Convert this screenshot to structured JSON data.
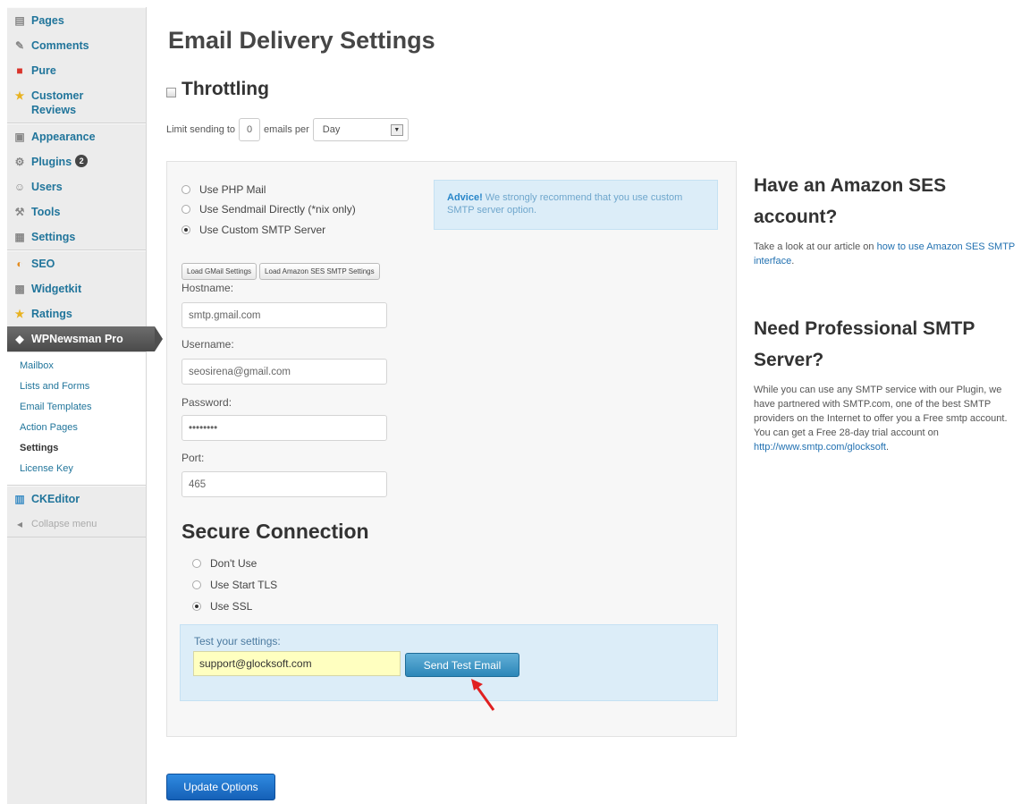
{
  "sidebar": {
    "items_top": [
      {
        "label": "Pages",
        "icon": "pages-icon",
        "glyph": "▤"
      },
      {
        "label": "Comments",
        "icon": "comments-icon",
        "glyph": "✎"
      },
      {
        "label": "Pure",
        "icon": "pure-icon",
        "glyph": "■"
      },
      {
        "label": "Customer Reviews",
        "icon": "star-icon",
        "glyph": "★"
      }
    ],
    "items_mid": [
      {
        "label": "Appearance",
        "icon": "appearance-icon",
        "glyph": "▣"
      },
      {
        "label": "Plugins",
        "icon": "plugins-icon",
        "glyph": "⚙",
        "badge": "2"
      },
      {
        "label": "Users",
        "icon": "users-icon",
        "glyph": "☺"
      },
      {
        "label": "Tools",
        "icon": "tools-icon",
        "glyph": "⚒"
      },
      {
        "label": "Settings",
        "icon": "settings-icon",
        "glyph": "▦"
      }
    ],
    "items_low": [
      {
        "label": "SEO",
        "icon": "seo-icon",
        "glyph": "◐"
      },
      {
        "label": "Widgetkit",
        "icon": "widgetkit-icon",
        "glyph": "▩"
      },
      {
        "label": "Ratings",
        "icon": "ratings-icon",
        "glyph": "★"
      }
    ],
    "active": {
      "label": "WPNewsman Pro",
      "icon": "wpnewsman-icon",
      "glyph": "◆"
    },
    "submenu": [
      "Mailbox",
      "Lists and Forms",
      "Email Templates",
      "Action Pages",
      "Settings",
      "License Key"
    ],
    "submenu_current": "Settings",
    "ckeditor": {
      "label": "CKEditor",
      "icon": "ckeditor-icon",
      "glyph": "▥"
    },
    "collapse": "Collapse menu"
  },
  "main": {
    "title": "Email Delivery Settings",
    "throttling": {
      "title": "Throttling",
      "limit_prefix": "Limit sending to",
      "limit_value": "0",
      "limit_mid": "emails per",
      "period": "Day"
    },
    "delivery_options": [
      {
        "label": "Use PHP Mail",
        "checked": false
      },
      {
        "label": "Use Sendmail Directly (*nix only)",
        "checked": false
      },
      {
        "label": "Use Custom SMTP Server",
        "checked": true
      }
    ],
    "advice": {
      "bold": "Advice!",
      "text": " We strongly recommend that you use custom SMTP server option."
    },
    "preset_buttons": [
      "Load GMail Settings",
      "Load Amazon SES SMTP Settings"
    ],
    "fields": {
      "hostname_label": "Hostname:",
      "hostname_value": "smtp.gmail.com",
      "username_label": "Username:",
      "username_value": "seosirena@gmail.com",
      "password_label": "Password:",
      "password_value": "••••••••",
      "port_label": "Port:",
      "port_value": "465"
    },
    "secure": {
      "title": "Secure Connection",
      "options": [
        {
          "label": "Don't Use",
          "checked": false
        },
        {
          "label": "Use Start TLS",
          "checked": false
        },
        {
          "label": "Use SSL",
          "checked": true
        }
      ]
    },
    "test": {
      "label": "Test your settings:",
      "email": "support@glocksoft.com",
      "button": "Send Test Email"
    },
    "update_button": "Update Options"
  },
  "right": {
    "ses_heading": "Have an Amazon SES account?",
    "ses_text": "Take a look at our article on ",
    "ses_link": "how to use Amazon SES SMTP interface",
    "ses_text_end": ".",
    "pro_heading": "Need Professional SMTP Server?",
    "pro_text": "While you can use any SMTP service with our Plugin, we have partnered with SMTP.com, one of the best SMTP providers on the Internet to offer you a Free smtp account. You can get a Free 28-day trial account on",
    "pro_link": "http://www.smtp.com/glocksoft",
    "pro_text_end": "."
  },
  "colors": {
    "accent": "#21759b",
    "panel": "#f7f7f7",
    "info": "#dcedf8",
    "update": "#1f74cc",
    "arrow": "#e02020"
  }
}
